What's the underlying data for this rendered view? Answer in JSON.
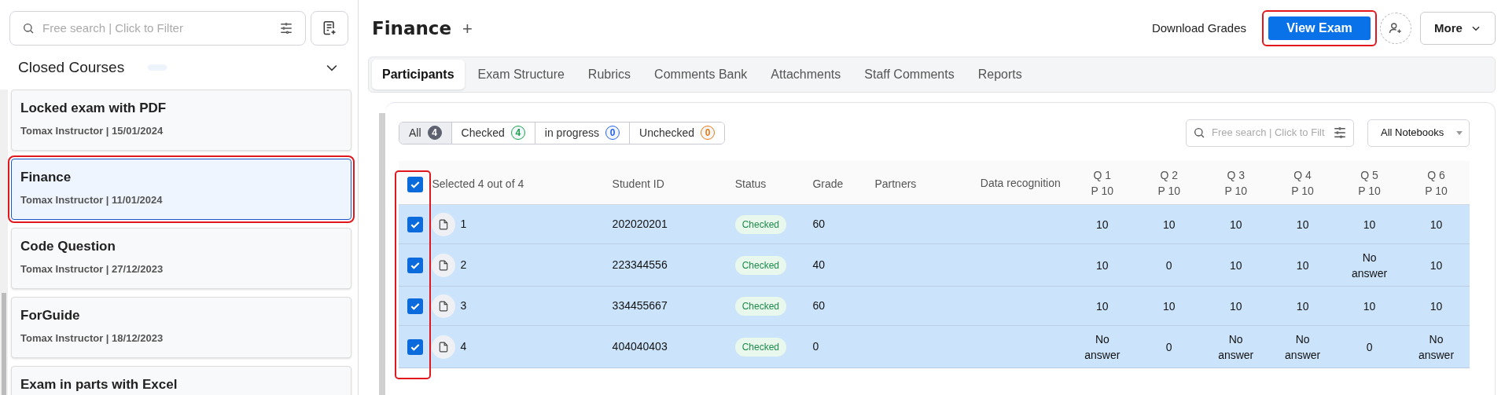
{
  "sidebar": {
    "search": {
      "placeholder": "Free search | Click to Filter"
    },
    "section_title": "Closed Courses",
    "courses": [
      {
        "title": "Locked exam with PDF",
        "meta": "Tomax Instructor | 15/01/2024",
        "selected": false,
        "highlighted": false
      },
      {
        "title": "Finance",
        "meta": "Tomax Instructor | 11/01/2024",
        "selected": true,
        "highlighted": true
      },
      {
        "title": "Code Question",
        "meta": "Tomax Instructor | 27/12/2023",
        "selected": false,
        "highlighted": false
      },
      {
        "title": "ForGuide",
        "meta": "Tomax Instructor | 18/12/2023",
        "selected": false,
        "highlighted": false
      },
      {
        "title": "Exam in parts with Excel",
        "selected": false,
        "highlighted": false
      }
    ]
  },
  "header": {
    "title": "Finance",
    "add_symbol": "+",
    "download_label": "Download Grades",
    "view_exam": {
      "label": "View Exam",
      "highlighted": true
    },
    "more_label": "More"
  },
  "tabs": [
    {
      "label": "Participants",
      "selected": true
    },
    {
      "label": "Exam Structure",
      "selected": false
    },
    {
      "label": "Rubrics",
      "selected": false
    },
    {
      "label": "Comments Bank",
      "selected": false
    },
    {
      "label": "Attachments",
      "selected": false
    },
    {
      "label": "Staff Comments",
      "selected": false
    },
    {
      "label": "Reports",
      "selected": false
    }
  ],
  "filters": [
    {
      "label": "All",
      "count": "4",
      "selected": true,
      "color": "#5f6170"
    },
    {
      "label": "Checked",
      "count": "4",
      "selected": false,
      "color": "#16a34a"
    },
    {
      "label": "in progress",
      "count": "0",
      "selected": false,
      "color": "#2563eb"
    },
    {
      "label": "Unchecked",
      "count": "0",
      "selected": false,
      "color": "#ea7a0c"
    }
  ],
  "table_search": {
    "placeholder": "Free search | Click to Filt"
  },
  "notebook_select": {
    "value": "All Notebooks"
  },
  "table": {
    "select_all_checked": true,
    "checkbox_column_highlighted": true,
    "selection_label": "Selected 4 out of 4",
    "columns": [
      "Student ID",
      "Status",
      "Grade",
      "Partners",
      "Data recognition"
    ],
    "question_columns": [
      {
        "question": "Q 1",
        "points": "P 10"
      },
      {
        "question": "Q 2",
        "points": "P 10"
      },
      {
        "question": "Q 3",
        "points": "P 10"
      },
      {
        "question": "Q 4",
        "points": "P 10"
      },
      {
        "question": "Q 5",
        "points": "P 10"
      },
      {
        "question": "Q 6",
        "points": "P 10"
      }
    ],
    "rows": [
      {
        "checked": true,
        "number": "1",
        "student_id": "202020201",
        "status": "Checked",
        "grade": "60",
        "answers": [
          "10",
          "10",
          "10",
          "10",
          "10",
          "10"
        ]
      },
      {
        "checked": true,
        "number": "2",
        "student_id": "223344556",
        "status": "Checked",
        "grade": "40",
        "answers": [
          "10",
          "0",
          "10",
          "10",
          "No answer",
          "10"
        ]
      },
      {
        "checked": true,
        "number": "3",
        "student_id": "334455667",
        "status": "Checked",
        "grade": "60",
        "answers": [
          "10",
          "10",
          "10",
          "10",
          "10",
          "10"
        ]
      },
      {
        "checked": true,
        "number": "4",
        "student_id": "404040403",
        "status": "Checked",
        "grade": "0",
        "answers": [
          "No answer",
          "0",
          "No answer",
          "No answer",
          "0",
          "No answer"
        ]
      }
    ]
  }
}
